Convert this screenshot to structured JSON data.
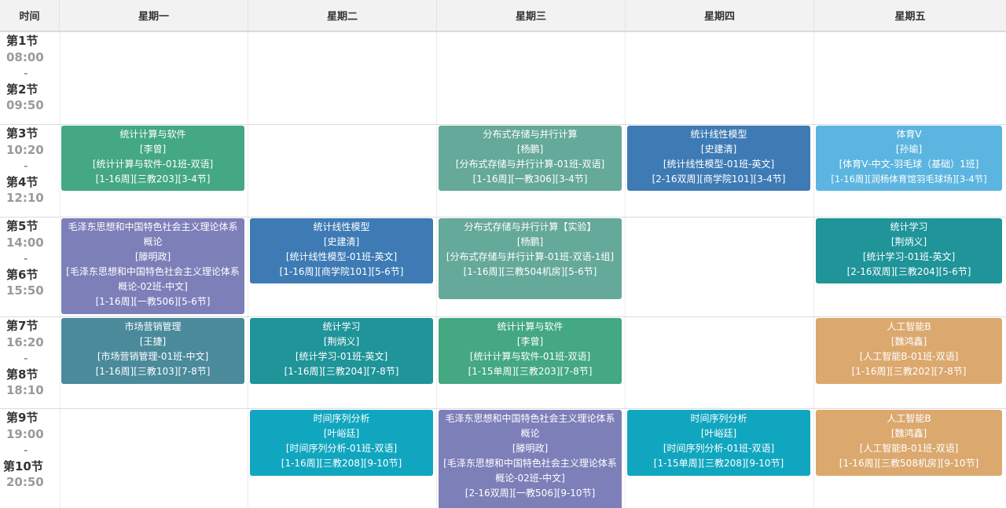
{
  "header": {
    "time_label": "时间",
    "days": [
      "星期一",
      "星期二",
      "星期三",
      "星期四",
      "星期五"
    ]
  },
  "time_rows": [
    {
      "start_period": "第1节",
      "start_time": "08:00",
      "dash": "-",
      "end_period": "第2节",
      "end_time": "09:50"
    },
    {
      "start_period": "第3节",
      "start_time": "10:20",
      "dash": "-",
      "end_period": "第4节",
      "end_time": "12:10"
    },
    {
      "start_period": "第5节",
      "start_time": "14:00",
      "dash": "-",
      "end_period": "第6节",
      "end_time": "15:50"
    },
    {
      "start_period": "第7节",
      "start_time": "16:20",
      "dash": "-",
      "end_period": "第8节",
      "end_time": "18:10"
    },
    {
      "start_period": "第9节",
      "start_time": "19:00",
      "dash": "-",
      "end_period": "第10节",
      "end_time": "20:50"
    }
  ],
  "colors": {
    "green": "#44a882",
    "teal_gray": "#65a99a",
    "steel_blue": "#3e7bb5",
    "sky": "#5bb5e0",
    "purple": "#7d7fb9",
    "slate": "#4a8a9b",
    "dark_teal": "#1f9499",
    "cyan": "#11a6bf",
    "orange": "#dba86e"
  },
  "courses": [
    {
      "day": 0,
      "row": 1,
      "color": "green",
      "name": "统计计算与软件",
      "teacher": "[李曾]",
      "class": "[统计计算与软件-01班-双语]",
      "schedule": "[1-16周][三教203][3-4节]"
    },
    {
      "day": 2,
      "row": 1,
      "color": "teal_gray",
      "name": "分布式存储与并行计算",
      "teacher": "[杨鹏]",
      "class": "[分布式存储与并行计算-01班-双语]",
      "schedule": "[1-16周][一教306][3-4节]"
    },
    {
      "day": 3,
      "row": 1,
      "color": "steel_blue",
      "name": "统计线性模型",
      "teacher": "[史建清]",
      "class": "[统计线性模型-01班-英文]",
      "schedule": "[2-16双周][商学院101][3-4节]"
    },
    {
      "day": 4,
      "row": 1,
      "color": "sky",
      "name": "体育Ⅴ",
      "teacher": "[孙瑜]",
      "class": "[体育Ⅴ-中文-羽毛球（基础）1班]",
      "schedule": "[1-16周][润杨体育馆羽毛球场][3-4节]"
    },
    {
      "day": 0,
      "row": 2,
      "color": "purple",
      "name": "毛泽东思想和中国特色社会主义理论体系概论",
      "teacher": "[滕明政]",
      "class": "[毛泽东思想和中国特色社会主义理论体系概论-02班-中文]",
      "schedule": "[1-16周][一教506][5-6节]"
    },
    {
      "day": 1,
      "row": 2,
      "color": "steel_blue",
      "name": "统计线性模型",
      "teacher": "[史建清]",
      "class": "[统计线性模型-01班-英文]",
      "schedule": "[1-16周][商学院101][5-6节]"
    },
    {
      "day": 2,
      "row": 2,
      "color": "teal_gray",
      "name": "分布式存储与并行计算【实验】",
      "teacher": "[杨鹏]",
      "class": "[分布式存储与并行计算-01班-双语-1组]",
      "schedule": "[1-16周][三教504机房][5-6节]"
    },
    {
      "day": 4,
      "row": 2,
      "color": "dark_teal",
      "name": "统计学习",
      "teacher": "[荆炳义]",
      "class": "[统计学习-01班-英文]",
      "schedule": "[2-16双周][三教204][5-6节]"
    },
    {
      "day": 0,
      "row": 3,
      "color": "slate",
      "name": "市场营销管理",
      "teacher": "[王捷]",
      "class": "[市场营销管理-01班-中文]",
      "schedule": "[1-16周][三教103][7-8节]"
    },
    {
      "day": 1,
      "row": 3,
      "color": "dark_teal",
      "name": "统计学习",
      "teacher": "[荆炳义]",
      "class": "[统计学习-01班-英文]",
      "schedule": "[1-16周][三教204][7-8节]"
    },
    {
      "day": 2,
      "row": 3,
      "color": "green",
      "name": "统计计算与软件",
      "teacher": "[李曾]",
      "class": "[统计计算与软件-01班-双语]",
      "schedule": "[1-15单周][三教203][7-8节]"
    },
    {
      "day": 4,
      "row": 3,
      "color": "orange",
      "name": "人工智能B",
      "teacher": "[魏鸿鑫]",
      "class": "[人工智能B-01班-双语]",
      "schedule": "[1-16周][三教202][7-8节]"
    },
    {
      "day": 1,
      "row": 4,
      "color": "cyan",
      "name": "时间序列分析",
      "teacher": "[叶峪廷]",
      "class": "[时间序列分析-01班-双语]",
      "schedule": "[1-16周][三教208][9-10节]"
    },
    {
      "day": 2,
      "row": 4,
      "color": "purple",
      "name": "毛泽东思想和中国特色社会主义理论体系概论",
      "teacher": "[滕明政]",
      "class": "[毛泽东思想和中国特色社会主义理论体系概论-02班-中文]",
      "schedule": "[2-16双周][一教506][9-10节]"
    },
    {
      "day": 3,
      "row": 4,
      "color": "cyan",
      "name": "时间序列分析",
      "teacher": "[叶峪廷]",
      "class": "[时间序列分析-01班-双语]",
      "schedule": "[1-15单周][三教208][9-10节]"
    },
    {
      "day": 4,
      "row": 4,
      "color": "orange",
      "name": "人工智能B",
      "teacher": "[魏鸿鑫]",
      "class": "[人工智能B-01班-双语]",
      "schedule": "[1-16周][三教508机房][9-10节]"
    }
  ]
}
